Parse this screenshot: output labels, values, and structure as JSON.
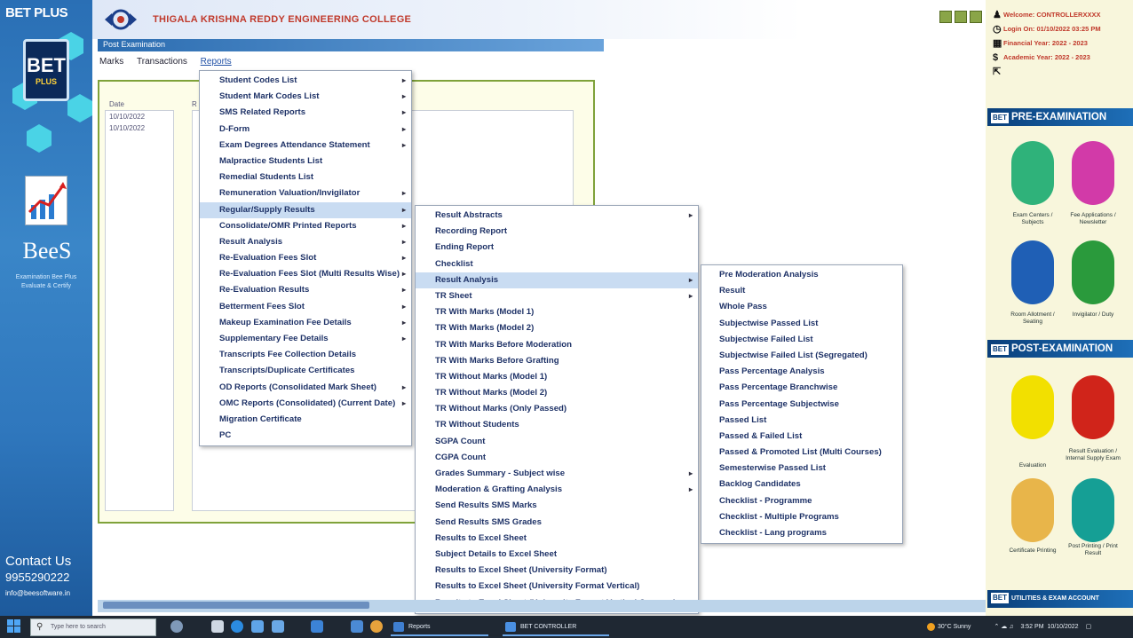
{
  "sidebar": {
    "brand": "BET PLUS",
    "logo_top": "BET",
    "logo_bottom": "PLUS",
    "bees_title": "BeeS",
    "bees_sub_1": "Examination Bee Plus",
    "bees_sub_2": "Evaluate & Certify",
    "contact_title": "Contact Us",
    "contact_phone": "9955290222",
    "contact_email": "info@beesoftware.in"
  },
  "header": {
    "college_name": "THIGALA KRISHNA REDDY ENGINEERING COLLEGE"
  },
  "breadcrumb": "Post Examination",
  "menubar": {
    "items": [
      "Marks",
      "Transactions",
      "Reports"
    ],
    "active": "Reports"
  },
  "content": {
    "col1_header": "Date",
    "col1_rows": [
      "10/10/2022",
      "10/10/2022"
    ],
    "col2_header": "R"
  },
  "menus": {
    "reports": [
      {
        "label": "Student Codes List",
        "sub": true
      },
      {
        "label": "Student Mark Codes List",
        "sub": true
      },
      {
        "label": "SMS Related Reports",
        "sub": true
      },
      {
        "label": "D-Form",
        "sub": true
      },
      {
        "label": "Exam Degrees Attendance Statement",
        "sub": true
      },
      {
        "label": "Malpractice Students List",
        "sub": false
      },
      {
        "label": "Remedial Students List",
        "sub": false
      },
      {
        "label": "Remuneration Valuation/Invigilator",
        "sub": true
      },
      {
        "label": "Regular/Supply Results",
        "sub": true,
        "highlight": true
      },
      {
        "label": "Consolidate/OMR Printed Reports",
        "sub": true
      },
      {
        "label": "Result Analysis",
        "sub": true
      },
      {
        "label": "Re-Evaluation Fees Slot",
        "sub": true
      },
      {
        "label": "Re-Evaluation Fees Slot (Multi Results Wise)",
        "sub": true
      },
      {
        "label": "Re-Evaluation Results",
        "sub": true
      },
      {
        "label": "Betterment Fees Slot",
        "sub": true
      },
      {
        "label": "Makeup Examination Fee Details",
        "sub": true
      },
      {
        "label": "Supplementary Fee Details",
        "sub": true
      },
      {
        "label": "Transcripts Fee Collection Details",
        "sub": false
      },
      {
        "label": "Transcripts/Duplicate Certificates",
        "sub": false
      },
      {
        "label": "OD Reports (Consolidated Mark Sheet)",
        "sub": true
      },
      {
        "label": "OMC Reports (Consolidated) (Current Date)",
        "sub": true
      },
      {
        "label": "Migration Certificate",
        "sub": false
      },
      {
        "label": "PC",
        "sub": false
      }
    ],
    "regular_supply": [
      {
        "label": "Result Abstracts",
        "sub": true
      },
      {
        "label": "Recording Report",
        "sub": false
      },
      {
        "label": "Ending Report",
        "sub": false
      },
      {
        "label": "Checklist",
        "sub": false
      },
      {
        "label": "Result Analysis",
        "sub": true,
        "highlight": true
      },
      {
        "label": "TR Sheet",
        "sub": true
      },
      {
        "label": "TR With Marks (Model 1)",
        "sub": false
      },
      {
        "label": "TR With Marks (Model 2)",
        "sub": false
      },
      {
        "label": "TR With Marks Before Moderation",
        "sub": false
      },
      {
        "label": "TR With Marks Before Grafting",
        "sub": false
      },
      {
        "label": "TR Without Marks (Model 1)",
        "sub": false
      },
      {
        "label": "TR Without Marks (Model 2)",
        "sub": false
      },
      {
        "label": "TR Without Marks (Only Passed)",
        "sub": false
      },
      {
        "label": "TR Without Students",
        "sub": false
      },
      {
        "label": "SGPA Count",
        "sub": false
      },
      {
        "label": "CGPA Count",
        "sub": false
      },
      {
        "label": "Grades Summary - Subject wise",
        "sub": true
      },
      {
        "label": "Moderation & Grafting Analysis",
        "sub": true
      },
      {
        "label": "Send Results SMS Marks",
        "sub": false
      },
      {
        "label": "Send Results SMS Grades",
        "sub": false
      },
      {
        "label": "Results to Excel Sheet",
        "sub": false
      },
      {
        "label": "Subject Details to Excel Sheet",
        "sub": false
      },
      {
        "label": "Results to Excel Sheet (University Format)",
        "sub": false
      },
      {
        "label": "Results to Excel Sheet (University Format Vertical)",
        "sub": false
      },
      {
        "label": "Results to Excel Sheet (University Format Vertical Courses)",
        "sub": false
      }
    ],
    "result_analysis": [
      {
        "label": "Pre Moderation Analysis"
      },
      {
        "label": "Result"
      },
      {
        "label": "Whole Pass"
      },
      {
        "label": "Subjectwise Passed List"
      },
      {
        "label": "Subjectwise Failed List"
      },
      {
        "label": "Subjectwise Failed List (Segregated)"
      },
      {
        "label": "Pass Percentage Analysis"
      },
      {
        "label": "Pass Percentage Branchwise"
      },
      {
        "label": "Pass Percentage Subjectwise"
      },
      {
        "label": "Passed List"
      },
      {
        "label": "Passed & Failed List"
      },
      {
        "label": "Passed & Promoted List (Multi Courses)"
      },
      {
        "label": "Semesterwise Passed List"
      },
      {
        "label": "Backlog Candidates"
      },
      {
        "label": "Checklist - Programme"
      },
      {
        "label": "Checklist - Multiple Programs"
      },
      {
        "label": "Checklist - Lang programs"
      }
    ]
  },
  "right_panel": {
    "info": [
      {
        "icon": "user",
        "text": "Welcome: CONTROLLERXXXX"
      },
      {
        "icon": "clock",
        "text": "Login On: 01/10/2022 03:25 PM"
      },
      {
        "icon": "calendar",
        "text": "Financial Year: 2022 - 2023"
      },
      {
        "icon": "dollar",
        "text": "Academic Year: 2022 - 2023"
      },
      {
        "icon": "export",
        "text": ""
      }
    ],
    "pre_exam_title": "PRE-EXAMINATION",
    "pre_exam_items": [
      {
        "label": "Exam Centers / Subjects",
        "color": "#2fb27a"
      },
      {
        "label": "Fee Applications / Newsletter",
        "color": "#d23aa8"
      },
      {
        "label": "Room Allotment / Seating",
        "color": "#1f5fb5"
      },
      {
        "label": "Invigilator / Duty",
        "color": "#2a9a3c"
      }
    ],
    "post_exam_title": "POST-EXAMINATION",
    "post_exam_items": [
      {
        "label": "Evaluation",
        "color": "#f2e000"
      },
      {
        "label": "Result Evaluation / Internal Supply Exam",
        "color": "#d0241a"
      },
      {
        "label": "Certificate Printing",
        "color": "#e8b54a"
      },
      {
        "label": "Post Printing / Print Result",
        "color": "#159f95"
      }
    ],
    "utilities_title": "UTILITIES & EXAM ACCOUNT"
  },
  "taskbar": {
    "search_placeholder": "Type here to search",
    "apps": [
      "Reports",
      "BET CONTROLLER"
    ],
    "weather": "30°C Sunny",
    "time": "3:52 PM",
    "date": "10/10/2022"
  }
}
